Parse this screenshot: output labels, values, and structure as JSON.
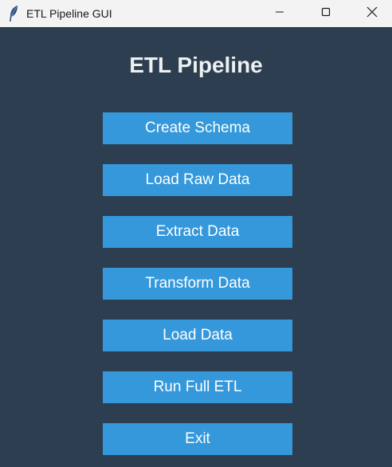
{
  "window": {
    "title": "ETL Pipeline GUI"
  },
  "main": {
    "heading": "ETL Pipeline",
    "buttons": [
      {
        "label": "Create Schema"
      },
      {
        "label": "Load Raw Data"
      },
      {
        "label": "Extract Data"
      },
      {
        "label": "Transform Data"
      },
      {
        "label": "Load Data"
      },
      {
        "label": "Run Full ETL"
      },
      {
        "label": "Exit"
      }
    ]
  },
  "colors": {
    "background": "#2c3e50",
    "button": "#3498db",
    "heading_text": "#ecf0f1",
    "titlebar": "#f3f3f3"
  },
  "icons": {
    "app": "feather-icon",
    "minimize": "minimize-icon",
    "maximize": "maximize-icon",
    "close": "close-icon"
  }
}
